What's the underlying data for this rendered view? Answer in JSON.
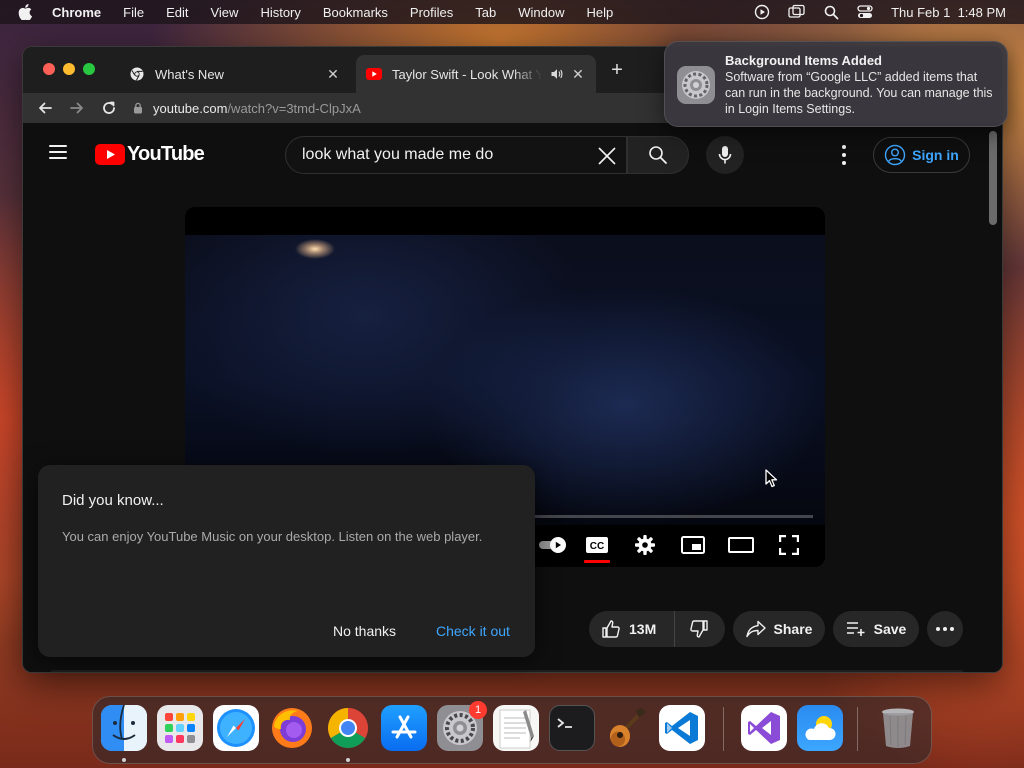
{
  "menubar": {
    "app": "Chrome",
    "items": [
      "File",
      "Edit",
      "View",
      "History",
      "Bookmarks",
      "Profiles",
      "Tab",
      "Window",
      "Help"
    ],
    "clock": "Thu Feb 1  1:48 PM"
  },
  "browser": {
    "tabs": [
      {
        "title": "What's New",
        "icon": "chrome-icon"
      },
      {
        "title": "Taylor Swift - Look What You Made Me Do",
        "icon": "youtube-icon",
        "audio": true
      }
    ],
    "url_host": "youtube.com",
    "url_path": "/watch?v=3tmd-ClpJxA"
  },
  "youtube": {
    "logo_text": "YouTube",
    "search_value": "look what you made me do",
    "signin_label": "Sign in",
    "like_count": "13M",
    "share_label": "Share",
    "save_label": "Save"
  },
  "popup": {
    "title": "Did you know...",
    "body": "You can enjoy YouTube Music on your desktop. Listen on the web player.",
    "decline_label": "No thanks",
    "accept_label": "Check it out"
  },
  "notification": {
    "title": "Background Items Added",
    "body": "Software from “Google LLC” added items that can run in the background. You can manage this in Login Items Settings."
  },
  "dock": {
    "apps": [
      "Finder",
      "Launchpad",
      "Safari",
      "Firefox",
      "Google Chrome",
      "App Store",
      "System Settings",
      "TextEdit",
      "Terminal",
      "GarageBand",
      "Visual Studio Code",
      "Visual Studio",
      "Weather",
      "Trash"
    ],
    "settings_badge": "1"
  },
  "colors": {
    "youtube_red": "#ff0000",
    "link_blue": "#3ea6ff",
    "page_bg": "#0f0f0f"
  }
}
